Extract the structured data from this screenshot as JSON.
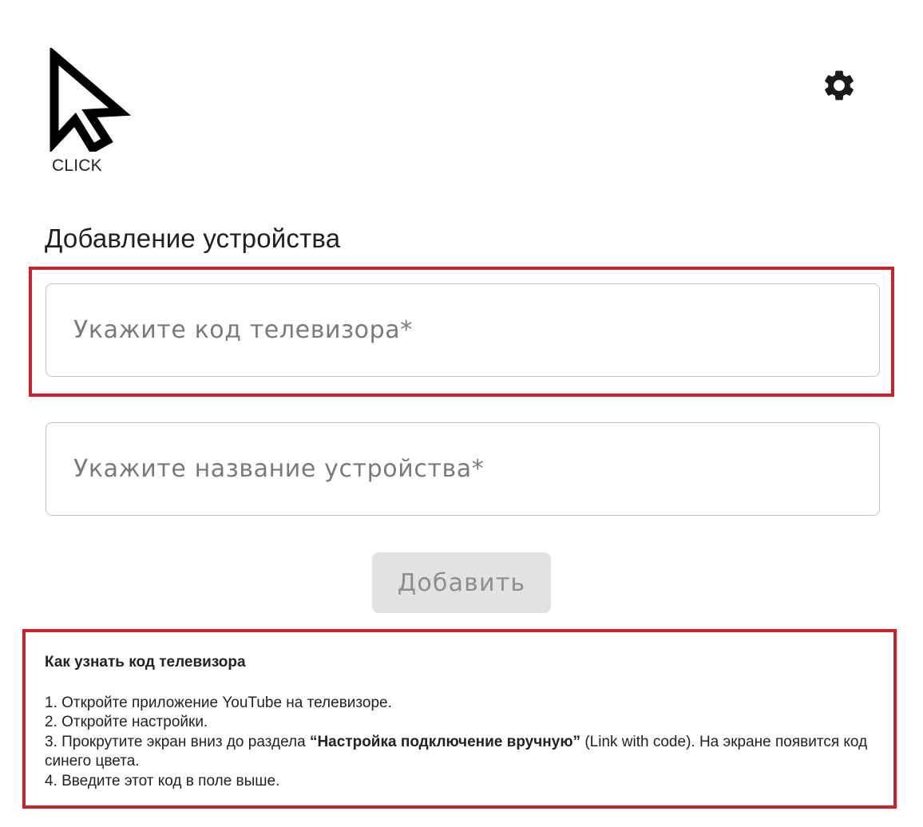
{
  "logo": {
    "label": "CLICK"
  },
  "header": {
    "settings_icon": "gear-icon"
  },
  "page": {
    "title": "Добавление устройства"
  },
  "form": {
    "tv_code_placeholder": "Укажите код телевизора*",
    "tv_code_value": "",
    "device_name_placeholder": "Укажите название устройства*",
    "device_name_value": "",
    "add_button_label": "Добавить"
  },
  "help": {
    "title": "Как узнать код телевизора",
    "step1": "1. Откройте приложение YouTube на телевизоре.",
    "step2": "2. Откройте настройки.",
    "step3_prefix": "3. Прокрутите экран вниз до раздела ",
    "step3_bold": "“Настройка подключение вручную”",
    "step3_suffix": " (Link with code). На экране появится код синего цвета.",
    "step4": "4. Введите этот код в поле выше."
  },
  "colors": {
    "highlight_border": "#c8222a",
    "button_disabled_bg": "#e2e2e2",
    "button_disabled_text": "#8e8e8e",
    "field_border": "#c4c4c4"
  }
}
